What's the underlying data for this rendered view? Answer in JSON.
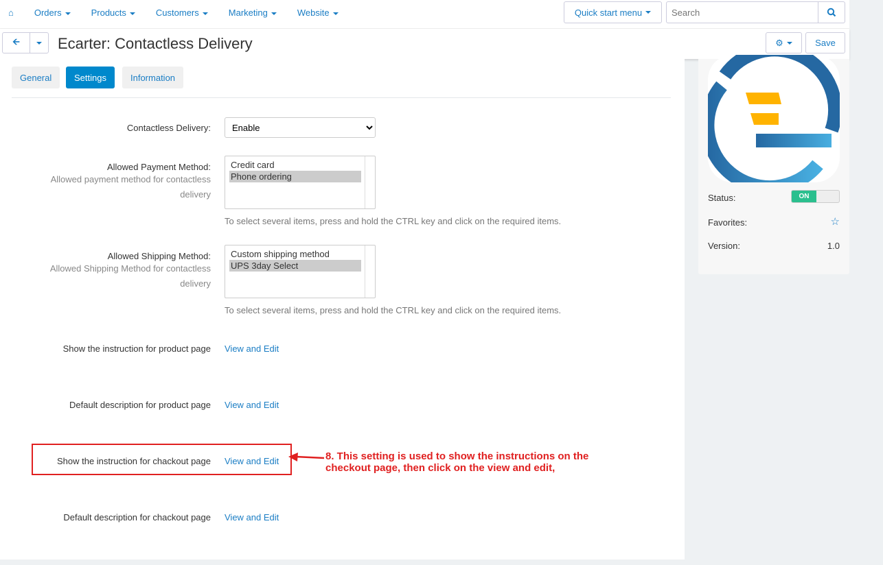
{
  "nav": {
    "items": [
      "Orders",
      "Products",
      "Customers",
      "Marketing",
      "Website"
    ],
    "quick_start": "Quick start menu",
    "search_placeholder": "Search"
  },
  "header": {
    "title": "Ecarter: Contactless Delivery",
    "save": "Save"
  },
  "tabs": [
    "General",
    "Settings",
    "Information"
  ],
  "form": {
    "contactless": {
      "label": "Contactless Delivery:",
      "value": "Enable"
    },
    "payment": {
      "label": "Allowed Payment Method:",
      "sub": "Allowed payment method for contactless delivery",
      "options": [
        "Credit card",
        "Phone ordering"
      ],
      "selected": "Phone ordering"
    },
    "shipping": {
      "label": "Allowed Shipping Method:",
      "sub": "Allowed Shipping Method for contactless delivery",
      "options": [
        "Custom shipping method",
        "UPS 3day Select"
      ],
      "selected": "UPS 3day Select"
    },
    "hint": "To select several items, press and hold the CTRL key and click on the required items.",
    "rows": [
      {
        "label": "Show the instruction for product page",
        "link": "View and Edit"
      },
      {
        "label": "Default description for product page",
        "link": "View and Edit"
      },
      {
        "label": "Show the instruction for chackout page",
        "link": "View and Edit"
      },
      {
        "label": "Default description for chackout page",
        "link": "View and Edit"
      }
    ]
  },
  "sidebar": {
    "status_label": "Status:",
    "status_value": "ON",
    "favorites_label": "Favorites:",
    "version_label": "Version:",
    "version": "1.0"
  },
  "annotation": {
    "line1": "8. This setting is used to show the instructions on the",
    "line2": "checkout page, then click on the view and edit,"
  },
  "colors": {
    "accent": "#0088cc",
    "on": "#2bbf8e",
    "annotation": "#e02020"
  }
}
